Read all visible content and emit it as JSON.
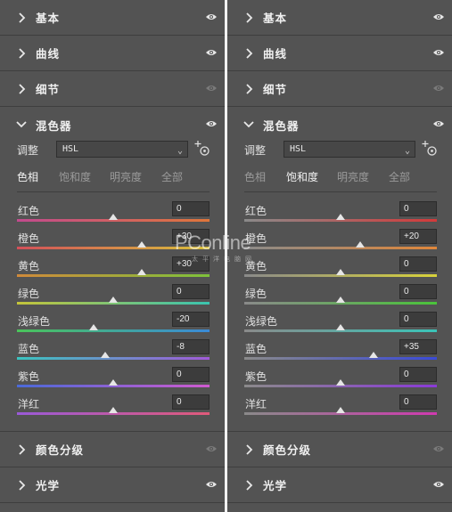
{
  "colors": {
    "panel_bg": "#535353",
    "divider": "#f2f2f2",
    "text": "#f0f0f0",
    "eye_on": "#e6e6e6",
    "eye_off": "#7a7a7a"
  },
  "watermark": {
    "brand": "PConline",
    "sub": "太平洋电脑网"
  },
  "panels": [
    {
      "sections_top": [
        {
          "title": "基本",
          "eye": "on"
        },
        {
          "title": "曲线",
          "eye": "on"
        },
        {
          "title": "细节",
          "eye": "off"
        }
      ],
      "mixer": {
        "title": "混色器",
        "eye": "on",
        "adjust_label": "调整",
        "mode_value": "HSL",
        "tabs": [
          "色相",
          "饱和度",
          "明亮度",
          "全部"
        ],
        "active_tab": 0,
        "rows": [
          {
            "name": "红色",
            "value": "0",
            "level": 0.5,
            "track": [
              "#c24a8e",
              "#e0763a"
            ]
          },
          {
            "name": "橙色",
            "value": "+30",
            "level": 0.65,
            "track": [
              "#d4505a",
              "#d8c03a"
            ]
          },
          {
            "name": "黄色",
            "value": "+30",
            "level": 0.65,
            "track": [
              "#d08a3a",
              "#7ec23a"
            ]
          },
          {
            "name": "绿色",
            "value": "0",
            "level": 0.5,
            "track": [
              "#c4c43a",
              "#3ac4b0"
            ]
          },
          {
            "name": "浅绿色",
            "value": "-20",
            "level": 0.4,
            "track": [
              "#4ac45a",
              "#3a8ad8"
            ]
          },
          {
            "name": "蓝色",
            "value": "-8",
            "level": 0.46,
            "track": [
              "#3ac4c0",
              "#a05ad8"
            ]
          },
          {
            "name": "紫色",
            "value": "0",
            "level": 0.5,
            "track": [
              "#4a6ad8",
              "#d05ad0"
            ]
          },
          {
            "name": "洋红",
            "value": "0",
            "level": 0.5,
            "track": [
              "#9a5ad8",
              "#e05a7a"
            ]
          }
        ]
      },
      "sections_bottom": [
        {
          "title": "颜色分级",
          "eye": "off"
        },
        {
          "title": "光学",
          "eye": "on"
        }
      ]
    },
    {
      "sections_top": [
        {
          "title": "基本",
          "eye": "on"
        },
        {
          "title": "曲线",
          "eye": "on"
        },
        {
          "title": "细节",
          "eye": "off"
        }
      ],
      "mixer": {
        "title": "混色器",
        "eye": "on",
        "adjust_label": "调整",
        "mode_value": "HSL",
        "tabs": [
          "色相",
          "饱和度",
          "明亮度",
          "全部"
        ],
        "active_tab": 1,
        "rows": [
          {
            "name": "红色",
            "value": "0",
            "level": 0.5,
            "track": [
              "#8a8a8a",
              "#d43a3a"
            ]
          },
          {
            "name": "橙色",
            "value": "+20",
            "level": 0.6,
            "track": [
              "#8a8a8a",
              "#e0873a"
            ]
          },
          {
            "name": "黄色",
            "value": "0",
            "level": 0.5,
            "track": [
              "#8a8a8a",
              "#d8d23a"
            ]
          },
          {
            "name": "绿色",
            "value": "0",
            "level": 0.5,
            "track": [
              "#8a8a8a",
              "#4ac43a"
            ]
          },
          {
            "name": "浅绿色",
            "value": "0",
            "level": 0.5,
            "track": [
              "#8a8a8a",
              "#3ac4b8"
            ]
          },
          {
            "name": "蓝色",
            "value": "+35",
            "level": 0.67,
            "track": [
              "#8a8a8a",
              "#3a4ad8"
            ]
          },
          {
            "name": "紫色",
            "value": "0",
            "level": 0.5,
            "track": [
              "#8a8a8a",
              "#8a3ad8"
            ]
          },
          {
            "name": "洋红",
            "value": "0",
            "level": 0.5,
            "track": [
              "#8a8a8a",
              "#d03ab0"
            ]
          }
        ]
      },
      "sections_bottom": [
        {
          "title": "颜色分级",
          "eye": "off"
        },
        {
          "title": "光学",
          "eye": "on"
        }
      ]
    }
  ]
}
